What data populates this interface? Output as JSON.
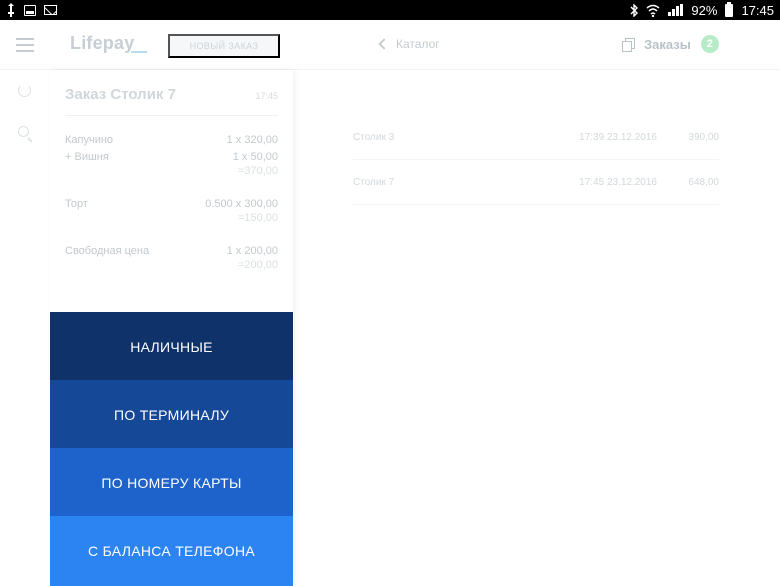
{
  "status_bar": {
    "battery_percent": "92%",
    "time": "17:45",
    "icons": [
      "usb-icon",
      "screenshot-icon",
      "mail-icon",
      "bluetooth-icon",
      "wifi-icon",
      "signal-icon",
      "battery-icon"
    ]
  },
  "app_bar": {
    "logo": "Lifepay",
    "new_order_label": "НОВЫЙ ЗАКАЗ",
    "catalog_label": "Каталог",
    "orders_label": "Заказы",
    "orders_count": "2"
  },
  "order": {
    "title": "Заказ Столик 7",
    "time": "17:45",
    "items": [
      {
        "name": "Капучино",
        "qty": "1 x 320,00",
        "sub_name": "+ Вишня",
        "sub_qty": "1 x 50,00",
        "sum": "=370,00"
      },
      {
        "name": "Торт",
        "qty": "0.500 x 300,00",
        "sub_name": "",
        "sub_qty": "",
        "sum": "=150,00"
      },
      {
        "name": "Свободная цена",
        "qty": "1 x 200,00",
        "sub_name": "",
        "sub_qty": "",
        "sum": "=200,00"
      }
    ]
  },
  "orders_list": [
    {
      "name": "Столик 3",
      "time": "17:39 23.12.2016",
      "amount": "390,00"
    },
    {
      "name": "Столик 7",
      "time": "17:45 23.12.2016",
      "amount": "648,00"
    }
  ],
  "payment": {
    "cash": "НАЛИЧНЫЕ",
    "terminal": "ПО ТЕРМИНАЛУ",
    "card_number": "ПО НОМЕРУ КАРТЫ",
    "phone_balance": "С БАЛАНСА ТЕЛЕФОНА"
  },
  "colors": {
    "cash": "#10326a",
    "terminal": "#154998",
    "card_number": "#1e63cb",
    "phone_balance": "#2c83f2"
  }
}
